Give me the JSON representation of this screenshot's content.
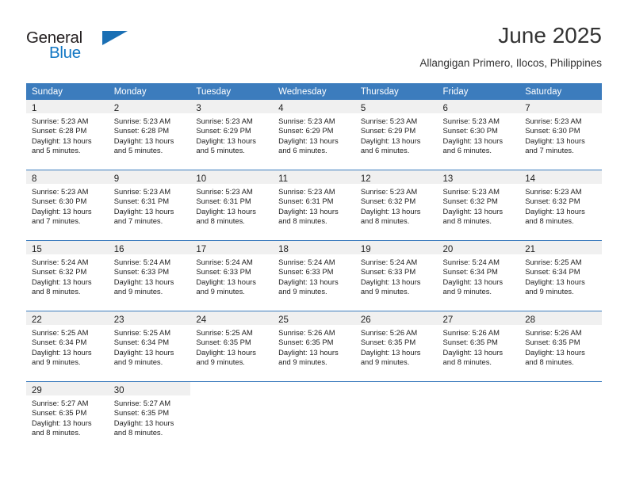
{
  "brand": {
    "name_part1": "General",
    "name_part2": "Blue",
    "triangle_color": "#1a6fb4",
    "blue_color": "#1277c4"
  },
  "header": {
    "title": "June 2025",
    "subtitle": "Allangigan Primero, Ilocos, Philippines"
  },
  "theme": {
    "header_band": "#3c7cbd",
    "daynum_band": "#f0f0f0",
    "text": "#222222"
  },
  "weekday_headers": [
    "Sunday",
    "Monday",
    "Tuesday",
    "Wednesday",
    "Thursday",
    "Friday",
    "Saturday"
  ],
  "weeks": [
    [
      {
        "day": "1",
        "sunrise": "Sunrise: 5:23 AM",
        "sunset": "Sunset: 6:28 PM",
        "daylight_1": "Daylight: 13 hours",
        "daylight_2": "and 5 minutes."
      },
      {
        "day": "2",
        "sunrise": "Sunrise: 5:23 AM",
        "sunset": "Sunset: 6:28 PM",
        "daylight_1": "Daylight: 13 hours",
        "daylight_2": "and 5 minutes."
      },
      {
        "day": "3",
        "sunrise": "Sunrise: 5:23 AM",
        "sunset": "Sunset: 6:29 PM",
        "daylight_1": "Daylight: 13 hours",
        "daylight_2": "and 5 minutes."
      },
      {
        "day": "4",
        "sunrise": "Sunrise: 5:23 AM",
        "sunset": "Sunset: 6:29 PM",
        "daylight_1": "Daylight: 13 hours",
        "daylight_2": "and 6 minutes."
      },
      {
        "day": "5",
        "sunrise": "Sunrise: 5:23 AM",
        "sunset": "Sunset: 6:29 PM",
        "daylight_1": "Daylight: 13 hours",
        "daylight_2": "and 6 minutes."
      },
      {
        "day": "6",
        "sunrise": "Sunrise: 5:23 AM",
        "sunset": "Sunset: 6:30 PM",
        "daylight_1": "Daylight: 13 hours",
        "daylight_2": "and 6 minutes."
      },
      {
        "day": "7",
        "sunrise": "Sunrise: 5:23 AM",
        "sunset": "Sunset: 6:30 PM",
        "daylight_1": "Daylight: 13 hours",
        "daylight_2": "and 7 minutes."
      }
    ],
    [
      {
        "day": "8",
        "sunrise": "Sunrise: 5:23 AM",
        "sunset": "Sunset: 6:30 PM",
        "daylight_1": "Daylight: 13 hours",
        "daylight_2": "and 7 minutes."
      },
      {
        "day": "9",
        "sunrise": "Sunrise: 5:23 AM",
        "sunset": "Sunset: 6:31 PM",
        "daylight_1": "Daylight: 13 hours",
        "daylight_2": "and 7 minutes."
      },
      {
        "day": "10",
        "sunrise": "Sunrise: 5:23 AM",
        "sunset": "Sunset: 6:31 PM",
        "daylight_1": "Daylight: 13 hours",
        "daylight_2": "and 8 minutes."
      },
      {
        "day": "11",
        "sunrise": "Sunrise: 5:23 AM",
        "sunset": "Sunset: 6:31 PM",
        "daylight_1": "Daylight: 13 hours",
        "daylight_2": "and 8 minutes."
      },
      {
        "day": "12",
        "sunrise": "Sunrise: 5:23 AM",
        "sunset": "Sunset: 6:32 PM",
        "daylight_1": "Daylight: 13 hours",
        "daylight_2": "and 8 minutes."
      },
      {
        "day": "13",
        "sunrise": "Sunrise: 5:23 AM",
        "sunset": "Sunset: 6:32 PM",
        "daylight_1": "Daylight: 13 hours",
        "daylight_2": "and 8 minutes."
      },
      {
        "day": "14",
        "sunrise": "Sunrise: 5:23 AM",
        "sunset": "Sunset: 6:32 PM",
        "daylight_1": "Daylight: 13 hours",
        "daylight_2": "and 8 minutes."
      }
    ],
    [
      {
        "day": "15",
        "sunrise": "Sunrise: 5:24 AM",
        "sunset": "Sunset: 6:32 PM",
        "daylight_1": "Daylight: 13 hours",
        "daylight_2": "and 8 minutes."
      },
      {
        "day": "16",
        "sunrise": "Sunrise: 5:24 AM",
        "sunset": "Sunset: 6:33 PM",
        "daylight_1": "Daylight: 13 hours",
        "daylight_2": "and 9 minutes."
      },
      {
        "day": "17",
        "sunrise": "Sunrise: 5:24 AM",
        "sunset": "Sunset: 6:33 PM",
        "daylight_1": "Daylight: 13 hours",
        "daylight_2": "and 9 minutes."
      },
      {
        "day": "18",
        "sunrise": "Sunrise: 5:24 AM",
        "sunset": "Sunset: 6:33 PM",
        "daylight_1": "Daylight: 13 hours",
        "daylight_2": "and 9 minutes."
      },
      {
        "day": "19",
        "sunrise": "Sunrise: 5:24 AM",
        "sunset": "Sunset: 6:33 PM",
        "daylight_1": "Daylight: 13 hours",
        "daylight_2": "and 9 minutes."
      },
      {
        "day": "20",
        "sunrise": "Sunrise: 5:24 AM",
        "sunset": "Sunset: 6:34 PM",
        "daylight_1": "Daylight: 13 hours",
        "daylight_2": "and 9 minutes."
      },
      {
        "day": "21",
        "sunrise": "Sunrise: 5:25 AM",
        "sunset": "Sunset: 6:34 PM",
        "daylight_1": "Daylight: 13 hours",
        "daylight_2": "and 9 minutes."
      }
    ],
    [
      {
        "day": "22",
        "sunrise": "Sunrise: 5:25 AM",
        "sunset": "Sunset: 6:34 PM",
        "daylight_1": "Daylight: 13 hours",
        "daylight_2": "and 9 minutes."
      },
      {
        "day": "23",
        "sunrise": "Sunrise: 5:25 AM",
        "sunset": "Sunset: 6:34 PM",
        "daylight_1": "Daylight: 13 hours",
        "daylight_2": "and 9 minutes."
      },
      {
        "day": "24",
        "sunrise": "Sunrise: 5:25 AM",
        "sunset": "Sunset: 6:35 PM",
        "daylight_1": "Daylight: 13 hours",
        "daylight_2": "and 9 minutes."
      },
      {
        "day": "25",
        "sunrise": "Sunrise: 5:26 AM",
        "sunset": "Sunset: 6:35 PM",
        "daylight_1": "Daylight: 13 hours",
        "daylight_2": "and 9 minutes."
      },
      {
        "day": "26",
        "sunrise": "Sunrise: 5:26 AM",
        "sunset": "Sunset: 6:35 PM",
        "daylight_1": "Daylight: 13 hours",
        "daylight_2": "and 9 minutes."
      },
      {
        "day": "27",
        "sunrise": "Sunrise: 5:26 AM",
        "sunset": "Sunset: 6:35 PM",
        "daylight_1": "Daylight: 13 hours",
        "daylight_2": "and 8 minutes."
      },
      {
        "day": "28",
        "sunrise": "Sunrise: 5:26 AM",
        "sunset": "Sunset: 6:35 PM",
        "daylight_1": "Daylight: 13 hours",
        "daylight_2": "and 8 minutes."
      }
    ],
    [
      {
        "day": "29",
        "sunrise": "Sunrise: 5:27 AM",
        "sunset": "Sunset: 6:35 PM",
        "daylight_1": "Daylight: 13 hours",
        "daylight_2": "and 8 minutes."
      },
      {
        "day": "30",
        "sunrise": "Sunrise: 5:27 AM",
        "sunset": "Sunset: 6:35 PM",
        "daylight_1": "Daylight: 13 hours",
        "daylight_2": "and 8 minutes."
      },
      null,
      null,
      null,
      null,
      null
    ]
  ]
}
